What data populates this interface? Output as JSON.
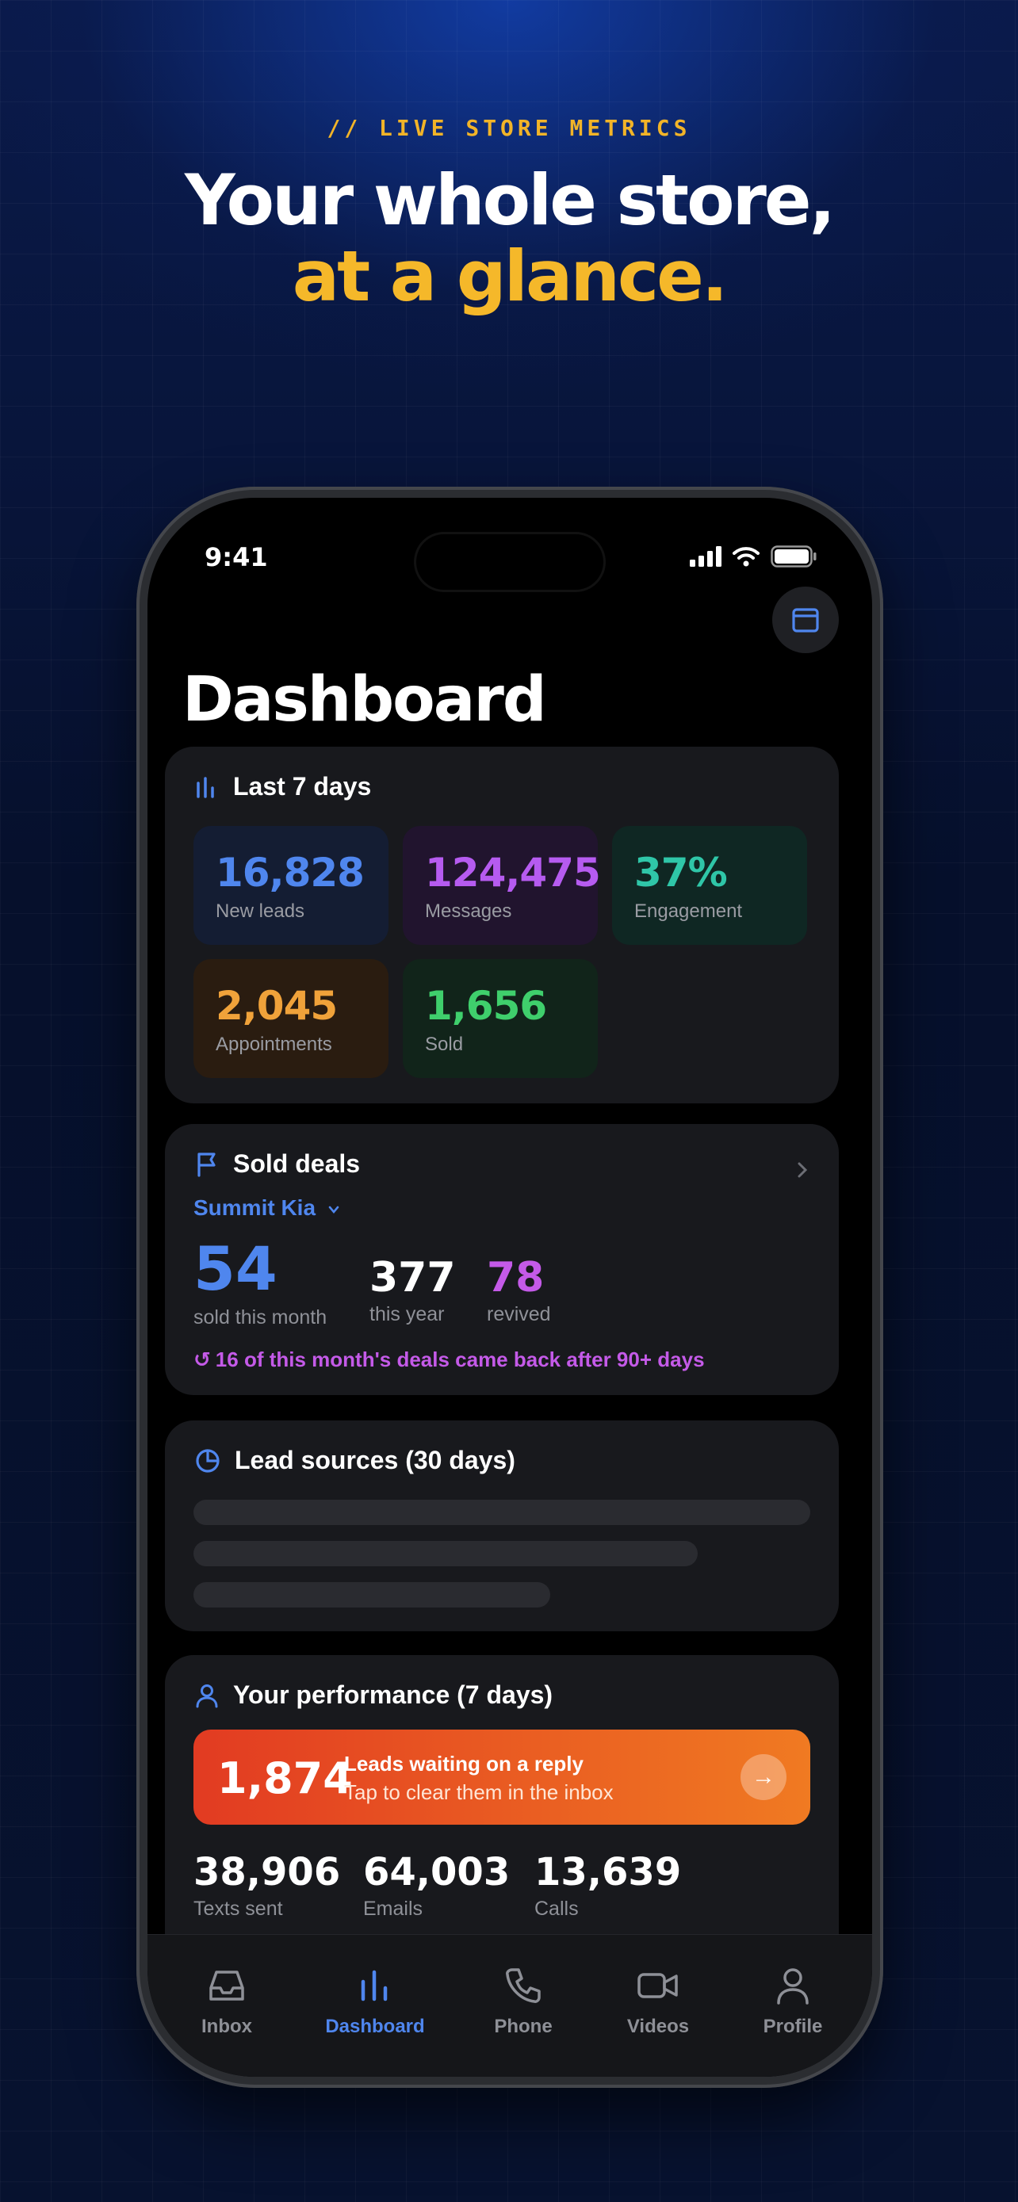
{
  "promo": {
    "eyebrow": "// LIVE STORE METRICS",
    "headline_line1": "Your whole store,",
    "headline_line2": "at a glance."
  },
  "status_bar": {
    "time": "9:41"
  },
  "header": {
    "title": "Dashboard",
    "calendar_icon": "calendar-icon"
  },
  "last7": {
    "title": "Last 7 days",
    "icon": "bar-chart-icon",
    "tiles": [
      {
        "value": "16,828",
        "label": "New leads",
        "color": "#4f86ee",
        "bg": "#141d33"
      },
      {
        "value": "124,475",
        "label": "Messages",
        "color": "#b65bf0",
        "bg": "#21142e"
      },
      {
        "value": "37%",
        "label": "Engagement",
        "color": "#2fc6a8",
        "bg": "#0f2723"
      },
      {
        "value": "2,045",
        "label": "Appointments",
        "color": "#f0a23a",
        "bg": "#2a1c10"
      },
      {
        "value": "1,656",
        "label": "Sold",
        "color": "#3fcf6c",
        "bg": "#11241a"
      }
    ]
  },
  "sold": {
    "title": "Sold deals",
    "icon": "flag-icon",
    "store": "Summit Kia",
    "month_value": "54",
    "month_label": "sold this month",
    "year_value": "377",
    "year_label": "this year",
    "revived_value": "78",
    "revived_label": "revived",
    "note": "16 of this month's deals came back after 90+ days"
  },
  "sources": {
    "title": "Lead sources (30 days)",
    "icon": "pie-chart-icon"
  },
  "performance": {
    "title": "Your performance (7 days)",
    "icon": "user-icon",
    "cta_value": "1,874",
    "cta_title": "Leads waiting on a reply",
    "cta_sub": "Tap to clear them in the inbox",
    "stats": [
      {
        "value": "38,906",
        "label": "Texts sent"
      },
      {
        "value": "64,003",
        "label": "Emails"
      },
      {
        "value": "13,639",
        "label": "Calls"
      }
    ]
  },
  "tabs": [
    {
      "label": "Inbox",
      "icon": "inbox-icon",
      "active": false
    },
    {
      "label": "Dashboard",
      "icon": "bar-chart-icon",
      "active": true
    },
    {
      "label": "Phone",
      "icon": "phone-icon",
      "active": false
    },
    {
      "label": "Videos",
      "icon": "video-icon",
      "active": false
    },
    {
      "label": "Profile",
      "icon": "user-icon",
      "active": false
    }
  ],
  "colors": {
    "accent": "#4f86ee",
    "gold": "#f5b82a",
    "purple": "#c45ae8"
  }
}
